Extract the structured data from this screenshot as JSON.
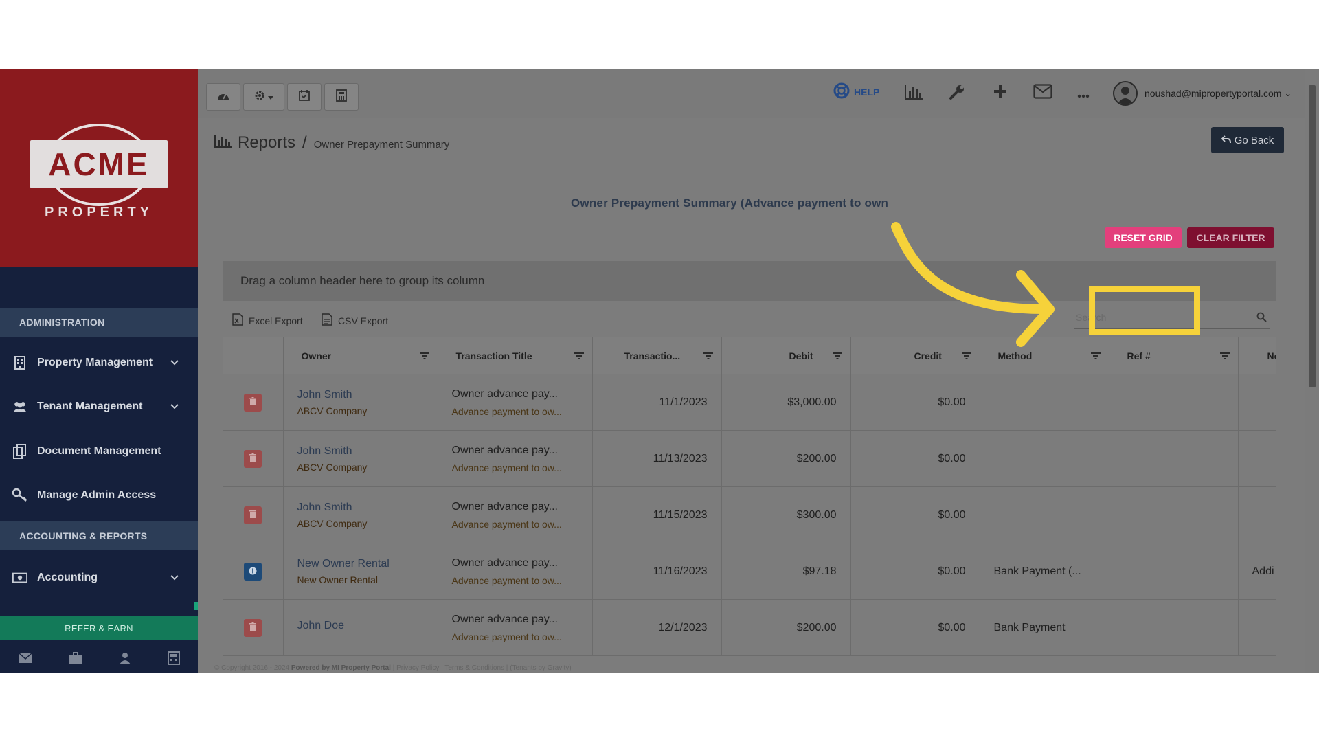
{
  "brand": {
    "logo_text": "ACME",
    "logo_sub": "PROPERTY"
  },
  "sidebar": {
    "sections": [
      {
        "label": "ADMINISTRATION"
      },
      {
        "label": "ACCOUNTING & REPORTS"
      }
    ],
    "items": [
      {
        "label": "Property Management",
        "icon": "building-icon",
        "expandable": true
      },
      {
        "label": "Tenant Management",
        "icon": "users-icon",
        "expandable": true
      },
      {
        "label": "Document Management",
        "icon": "documents-icon",
        "expandable": false
      },
      {
        "label": "Manage Admin Access",
        "icon": "key-icon",
        "expandable": false
      },
      {
        "label": "Accounting",
        "icon": "money-icon",
        "expandable": true
      }
    ],
    "refer_label": "REFER & EARN",
    "bottom_icons": [
      "mail-icon",
      "briefcase-icon",
      "user-icon",
      "calculator-icon"
    ]
  },
  "topbar": {
    "help_label": "HELP",
    "user_email": "noushad@mipropertyportal.com",
    "caret": "⌄"
  },
  "breadcrumb": {
    "title": "Reports",
    "separator": "/",
    "current": "Owner Prepayment Summary"
  },
  "go_back_label": "Go Back",
  "report_title": "Owner Prepayment Summary (Advance payment to own",
  "buttons": {
    "reset_grid": "RESET GRID",
    "clear_filter": "CLEAR FILTER"
  },
  "grid": {
    "group_panel": "Drag a column header here to group its column",
    "excel_export": "Excel Export",
    "csv_export": "CSV Export",
    "search_placeholder": "Search",
    "columns": [
      "Owner",
      "Transaction Title",
      "Transactio...",
      "Debit",
      "Credit",
      "Method",
      "Ref #",
      "Note"
    ],
    "rows": [
      {
        "action": "delete",
        "owner": "John Smith",
        "company": "ABCV Company",
        "title": "Owner advance pay...",
        "subtitle": "Advance payment to ow...",
        "date": "11/1/2023",
        "debit": "$3,000.00",
        "credit": "$0.00",
        "method": "",
        "ref": "",
        "note": ""
      },
      {
        "action": "delete",
        "owner": "John Smith",
        "company": "ABCV Company",
        "title": "Owner advance pay...",
        "subtitle": "Advance payment to ow...",
        "date": "11/13/2023",
        "debit": "$200.00",
        "credit": "$0.00",
        "method": "",
        "ref": "",
        "note": ""
      },
      {
        "action": "delete",
        "owner": "John Smith",
        "company": "ABCV Company",
        "title": "Owner advance pay...",
        "subtitle": "Advance payment to ow...",
        "date": "11/15/2023",
        "debit": "$300.00",
        "credit": "$0.00",
        "method": "",
        "ref": "",
        "note": ""
      },
      {
        "action": "info",
        "owner": "New Owner Rental",
        "company": "New Owner Rental",
        "title": "Owner advance pay...",
        "subtitle": "Advance payment to ow...",
        "date": "11/16/2023",
        "debit": "$97.18",
        "credit": "$0.00",
        "method": "Bank Payment (...",
        "ref": "",
        "note": "Addi"
      },
      {
        "action": "delete",
        "owner": "John Doe",
        "company": "",
        "title": "Owner advance pay...",
        "subtitle": "Advance payment to ow...",
        "date": "12/1/2023",
        "debit": "$200.00",
        "credit": "$0.00",
        "method": "Bank Payment",
        "ref": "",
        "note": ""
      }
    ]
  },
  "footer": {
    "copyright": "© Copyright 2016 - 2024",
    "powered": "Powered by MI Property Portal",
    "privacy": "Privacy Policy",
    "terms": "Terms & Conditions",
    "extra": "(Tenants by Gravity)"
  },
  "colors": {
    "reset": "#e33f7c",
    "clear": "#7e0f30",
    "highlight": "#f6d23a",
    "sidebar": "#15203c",
    "logo_bg": "#8b1a1e"
  }
}
